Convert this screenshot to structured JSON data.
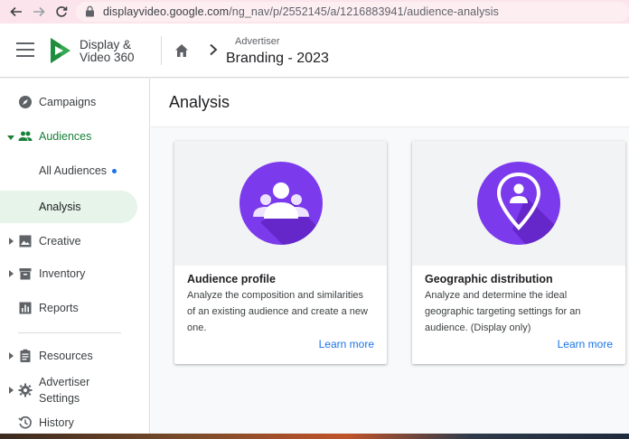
{
  "browser": {
    "url_host": "displayvideo.google.com",
    "url_path": "/ng_nav/p/2552145/a/1216883941/audience-analysis"
  },
  "header": {
    "product_line1": "Display &",
    "product_line2": "Video 360",
    "breadcrumb_label": "Advertiser",
    "breadcrumb_value": "Branding - 2023"
  },
  "sidebar": {
    "items": [
      {
        "label": "Campaigns",
        "icon": "compass-icon"
      },
      {
        "label": "Audiences",
        "icon": "people-icon"
      },
      {
        "label": "All Audiences"
      },
      {
        "label": "Analysis"
      },
      {
        "label": "Creative",
        "icon": "image-icon"
      },
      {
        "label": "Inventory",
        "icon": "inventory-icon"
      },
      {
        "label": "Reports",
        "icon": "bar-chart-icon"
      },
      {
        "label": "Resources",
        "icon": "clipboard-icon"
      },
      {
        "label": "Advertiser Settings",
        "label_line1": "Advertiser",
        "label_line2": "Settings",
        "icon": "gear-icon"
      },
      {
        "label": "History",
        "icon": "history-icon"
      }
    ]
  },
  "main": {
    "title": "Analysis",
    "cards": [
      {
        "title": "Audience profile",
        "description": "Analyze the composition and similarities of an existing audience and create a new one.",
        "link": "Learn more",
        "icon": "audience-group-icon"
      },
      {
        "title": "Geographic distribution",
        "description": "Analyze and determine the ideal geographic targeting settings for an audience. (Display only)",
        "link": "Learn more",
        "icon": "location-person-icon"
      }
    ]
  },
  "colors": {
    "accent_green": "#188038",
    "selected_bg": "#e6f4ea",
    "link_blue": "#1a73e8",
    "icon_purple": "#7b2ff7"
  }
}
